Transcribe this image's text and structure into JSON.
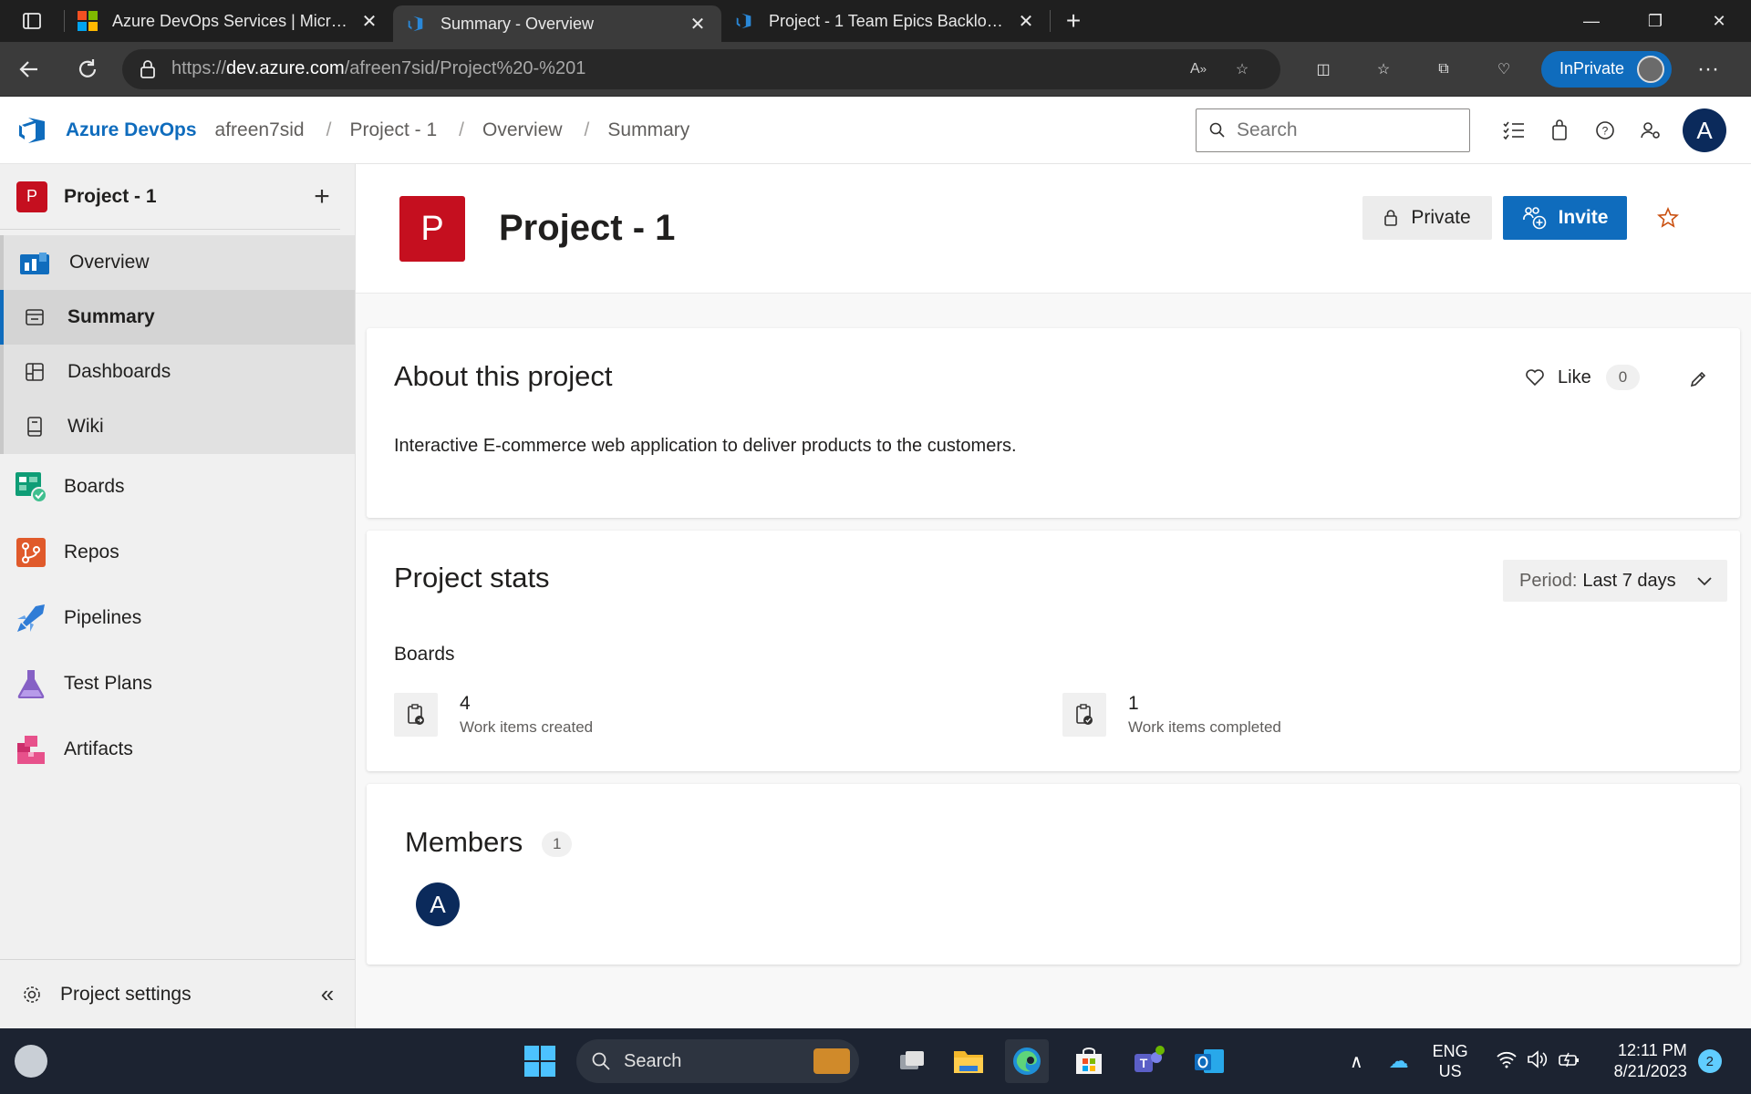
{
  "browser": {
    "tabs": [
      {
        "title": "Azure DevOps Services | Microsoft Azure",
        "icon": "microsoft-logo-icon"
      },
      {
        "title": "Summary - Overview",
        "icon": "azure-devops-icon"
      },
      {
        "title": "Project - 1 Team Epics Backlog - Boards",
        "icon": "azure-devops-icon"
      }
    ],
    "url_prefix": "https://",
    "url_domain": "dev.azure.com",
    "url_path": "/afreen7sid/Project%20-%201",
    "inprivate_label": "InPrivate"
  },
  "header": {
    "brand": "Azure DevOps",
    "org": "afreen7sid",
    "breadcrumb": [
      "Project - 1",
      "Overview",
      "Summary"
    ],
    "search_placeholder": "Search",
    "avatar_letter": "A"
  },
  "sidebar": {
    "project_letter": "P",
    "project_name": "Project - 1",
    "overview_label": "Overview",
    "sub_items": [
      "Summary",
      "Dashboards",
      "Wiki"
    ],
    "main_items": [
      "Boards",
      "Repos",
      "Pipelines",
      "Test Plans",
      "Artifacts"
    ],
    "settings_label": "Project settings"
  },
  "project": {
    "badge_letter": "P",
    "title": "Project - 1",
    "private_label": "Private",
    "invite_label": "Invite"
  },
  "about": {
    "title": "About this project",
    "like_label": "Like",
    "like_count": "0",
    "description": "Interactive E-commerce web application to deliver products to the customers."
  },
  "stats": {
    "title": "Project stats",
    "period_label": "Period:",
    "period_value": "Last 7 days",
    "section": "Boards",
    "items": [
      {
        "value": "4",
        "caption": "Work items created"
      },
      {
        "value": "1",
        "caption": "Work items completed"
      }
    ]
  },
  "members": {
    "title": "Members",
    "count": "1",
    "avatar_letter": "A"
  },
  "taskbar": {
    "search_label": "Search",
    "lang_1": "ENG",
    "lang_2": "US",
    "time": "12:11 PM",
    "date": "8/21/2023",
    "notifications": "2"
  },
  "colors": {
    "accent": "#0f6cbd",
    "project_badge": "#c50f1f",
    "avatar": "#0b2a5b"
  }
}
